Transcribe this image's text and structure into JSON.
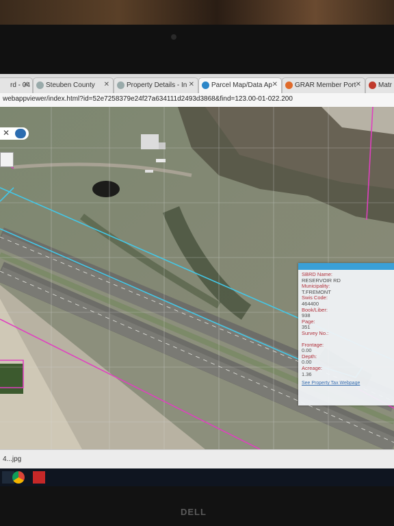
{
  "browser": {
    "tabs": [
      {
        "label": "rd - 04",
        "icon": "doc-icon",
        "active": false
      },
      {
        "label": "Steuben County",
        "icon": "globe-icon",
        "active": false
      },
      {
        "label": "Property Details - In",
        "icon": "globe-icon",
        "active": false
      },
      {
        "label": "Parcel Map/Data Ap",
        "icon": "map-app-icon",
        "active": true
      },
      {
        "label": "GRAR Member Port",
        "icon": "grar-icon",
        "active": false
      },
      {
        "label": "Matr",
        "icon": "matrix-icon",
        "active": false
      }
    ],
    "url": "webappviewer/index.html?id=52e7258379e24f27a634111d2493d3868&find=123.00-01-022.200"
  },
  "map": {
    "search": {
      "clear_glyph": "✕",
      "button_icon": "search-icon"
    },
    "popup": {
      "fields": [
        {
          "label": "SBRD Name:",
          "value": "RESERVOIR RD"
        },
        {
          "label": "Municipality:",
          "value": "T.FREMONT"
        },
        {
          "label": "Swis Code:",
          "value": "464400"
        },
        {
          "label": "Book/Liber:",
          "value": "938"
        },
        {
          "label": "Page:",
          "value": "351"
        },
        {
          "label": "Survey No.:",
          "value": ""
        },
        {
          "label": "Frontage:",
          "value": "0.00"
        },
        {
          "label": "Depth:",
          "value": "0.00"
        },
        {
          "label": "Acreage:",
          "value": "1.36"
        }
      ],
      "link": "See Property Tax Webpage"
    },
    "toolbar": {
      "prev": "‹",
      "next": "›",
      "tools": [
        "layers-icon",
        "basemap-icon",
        "grid-icon"
      ]
    }
  },
  "downloads": {
    "file": "4...jpg"
  },
  "taskbar": {
    "icons": [
      "windows-icon",
      "chrome-icon",
      "pdf-icon"
    ]
  },
  "device": {
    "brand": "DELL"
  },
  "colors": {
    "parcel_line": "#e040c0",
    "lot_line": "#43c8e8",
    "accent": "#3aa0d8"
  }
}
